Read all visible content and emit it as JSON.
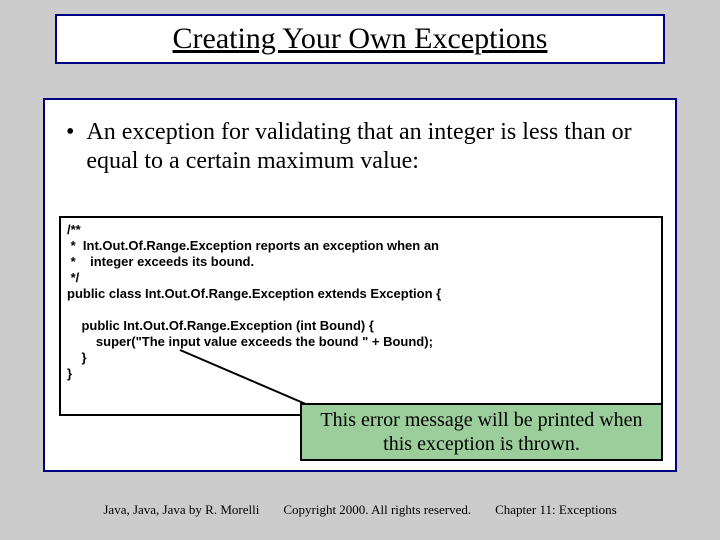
{
  "title": "Creating Your Own Exceptions",
  "bullet": "An exception for validating that an integer is less than or equal to a certain maximum value:",
  "code": {
    "l1": "/**",
    "l2": " *  Int.Out.Of.Range.Exception reports an exception when an",
    "l3": " *    integer exceeds its bound.",
    "l4": " */",
    "l5": "public class Int.Out.Of.Range.Exception extends Exception {",
    "l6": "",
    "l7": "    public Int.Out.Of.Range.Exception (int Bound) {",
    "l8": "        super(\"The input value exceeds the bound \" + Bound);",
    "l9": "    }",
    "l10": "}"
  },
  "callout": "This error message will be printed when this exception is thrown.",
  "footer": {
    "left": "Java, Java, Java by R. Morelli",
    "center": "Copyright 2000. All rights reserved.",
    "right": "Chapter 11: Exceptions"
  }
}
